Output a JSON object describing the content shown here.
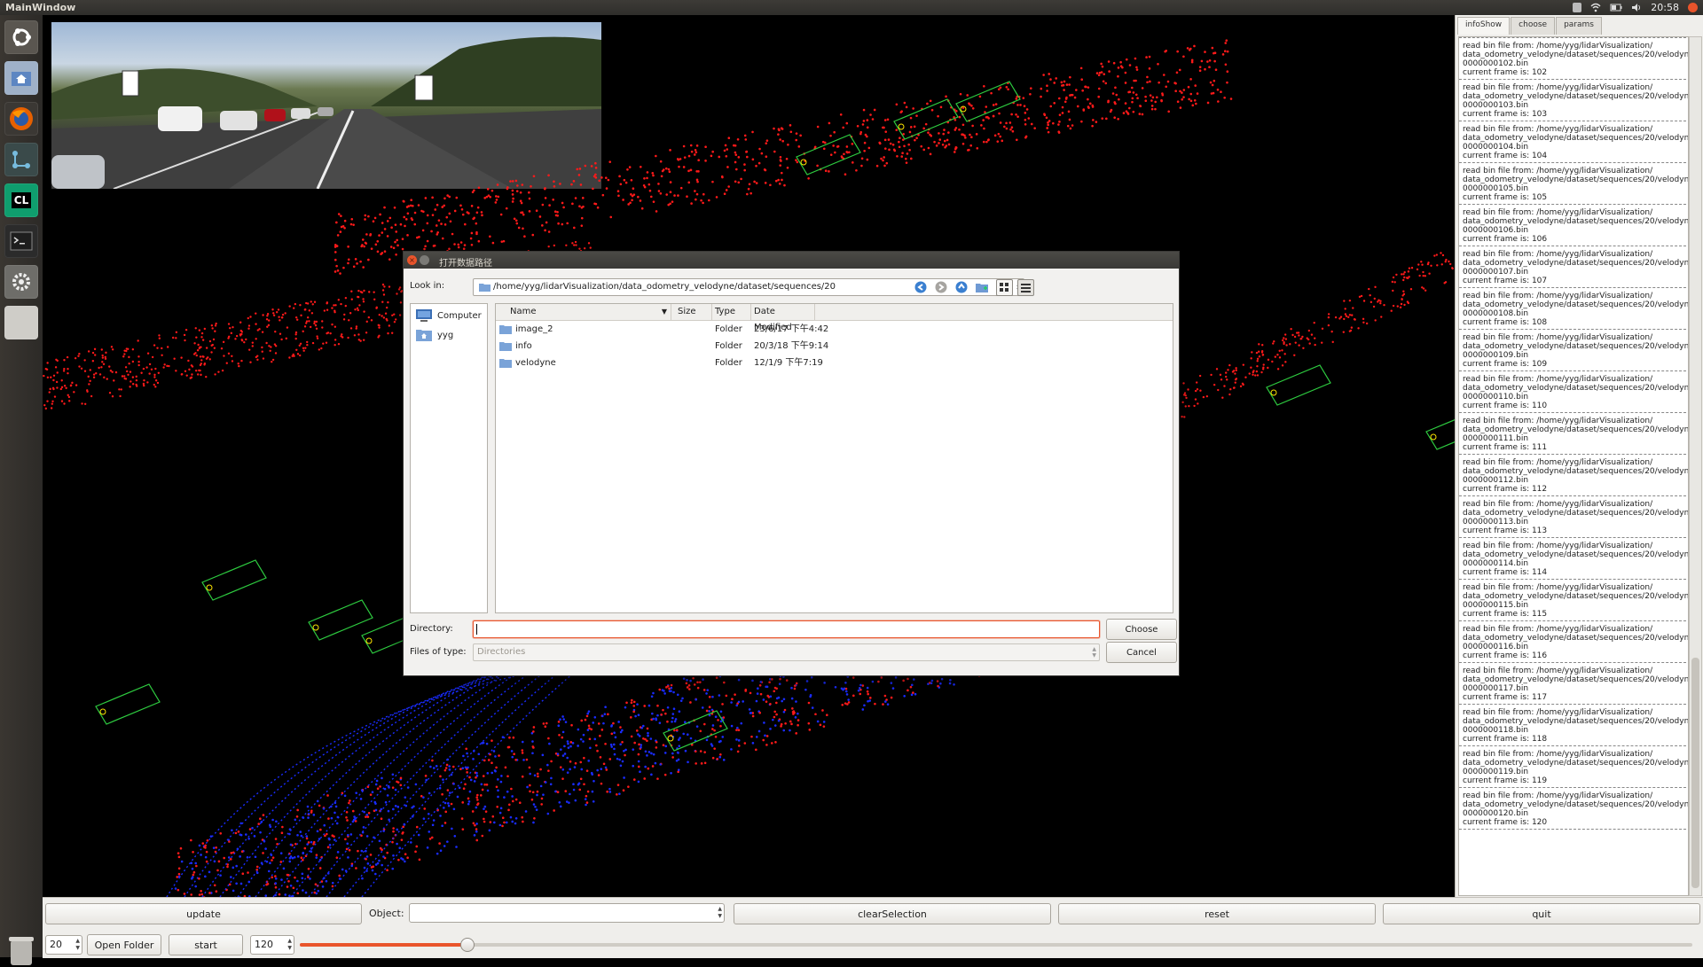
{
  "window": {
    "title": "MainWindow",
    "clock": "20:58"
  },
  "colors": {
    "accent": "#e9542b",
    "point_red": "#ff1a1a",
    "point_blue": "#1a2cff",
    "box_green": "#2ecc40",
    "box_yellow": "#ffe600"
  },
  "launcher": [
    "ubuntu-dash-icon",
    "files-icon",
    "firefox-icon",
    "network-tool-icon",
    "clion-icon",
    "terminal-icon",
    "settings-icon",
    "blank-app-icon"
  ],
  "launcher_clion_text": "CL",
  "right_panel": {
    "tabs": [
      "infoShow",
      "choose",
      "params"
    ],
    "log": [
      {
        "line1": "read bin file from: /home/yyg/lidarVisualization/",
        "line2": "data_odometry_velodyne/dataset/sequences/20/velodyne/",
        "line3": "0000000102.bin",
        "line4": "current frame is: 102"
      },
      {
        "line1": "read bin file from: /home/yyg/lidarVisualization/",
        "line2": "data_odometry_velodyne/dataset/sequences/20/velodyne/",
        "line3": "0000000103.bin",
        "line4": "current frame is: 103"
      },
      {
        "line1": "read bin file from: /home/yyg/lidarVisualization/",
        "line2": "data_odometry_velodyne/dataset/sequences/20/velodyne/",
        "line3": "0000000104.bin",
        "line4": "current frame is: 104"
      },
      {
        "line1": "read bin file from: /home/yyg/lidarVisualization/",
        "line2": "data_odometry_velodyne/dataset/sequences/20/velodyne/",
        "line3": "0000000105.bin",
        "line4": "current frame is: 105"
      },
      {
        "line1": "read bin file from: /home/yyg/lidarVisualization/",
        "line2": "data_odometry_velodyne/dataset/sequences/20/velodyne/",
        "line3": "0000000106.bin",
        "line4": "current frame is: 106"
      },
      {
        "line1": "read bin file from: /home/yyg/lidarVisualization/",
        "line2": "data_odometry_velodyne/dataset/sequences/20/velodyne/",
        "line3": "0000000107.bin",
        "line4": "current frame is: 107"
      },
      {
        "line1": "read bin file from: /home/yyg/lidarVisualization/",
        "line2": "data_odometry_velodyne/dataset/sequences/20/velodyne/",
        "line3": "0000000108.bin",
        "line4": "current frame is: 108"
      },
      {
        "line1": "read bin file from: /home/yyg/lidarVisualization/",
        "line2": "data_odometry_velodyne/dataset/sequences/20/velodyne/",
        "line3": "0000000109.bin",
        "line4": "current frame is: 109"
      },
      {
        "line1": "read bin file from: /home/yyg/lidarVisualization/",
        "line2": "data_odometry_velodyne/dataset/sequences/20/velodyne/",
        "line3": "0000000110.bin",
        "line4": "current frame is: 110"
      },
      {
        "line1": "read bin file from: /home/yyg/lidarVisualization/",
        "line2": "data_odometry_velodyne/dataset/sequences/20/velodyne/",
        "line3": "0000000111.bin",
        "line4": "current frame is: 111"
      },
      {
        "line1": "read bin file from: /home/yyg/lidarVisualization/",
        "line2": "data_odometry_velodyne/dataset/sequences/20/velodyne/",
        "line3": "0000000112.bin",
        "line4": "current frame is: 112"
      },
      {
        "line1": "read bin file from: /home/yyg/lidarVisualization/",
        "line2": "data_odometry_velodyne/dataset/sequences/20/velodyne/",
        "line3": "0000000113.bin",
        "line4": "current frame is: 113"
      },
      {
        "line1": "read bin file from: /home/yyg/lidarVisualization/",
        "line2": "data_odometry_velodyne/dataset/sequences/20/velodyne/",
        "line3": "0000000114.bin",
        "line4": "current frame is: 114"
      },
      {
        "line1": "read bin file from: /home/yyg/lidarVisualization/",
        "line2": "data_odometry_velodyne/dataset/sequences/20/velodyne/",
        "line3": "0000000115.bin",
        "line4": "current frame is: 115"
      },
      {
        "line1": "read bin file from: /home/yyg/lidarVisualization/",
        "line2": "data_odometry_velodyne/dataset/sequences/20/velodyne/",
        "line3": "0000000116.bin",
        "line4": "current frame is: 116"
      },
      {
        "line1": "read bin file from: /home/yyg/lidarVisualization/",
        "line2": "data_odometry_velodyne/dataset/sequences/20/velodyne/",
        "line3": "0000000117.bin",
        "line4": "current frame is: 117"
      },
      {
        "line1": "read bin file from: /home/yyg/lidarVisualization/",
        "line2": "data_odometry_velodyne/dataset/sequences/20/velodyne/",
        "line3": "0000000118.bin",
        "line4": "current frame is: 118"
      },
      {
        "line1": "read bin file from: /home/yyg/lidarVisualization/",
        "line2": "data_odometry_velodyne/dataset/sequences/20/velodyne/",
        "line3": "0000000119.bin",
        "line4": "current frame is: 119"
      },
      {
        "line1": "read bin file from: /home/yyg/lidarVisualization/",
        "line2": "data_odometry_velodyne/dataset/sequences/20/velodyne/",
        "line3": "0000000120.bin",
        "line4": "current frame is: 120"
      }
    ]
  },
  "controls": {
    "update": "update",
    "object_label": "Object:",
    "object_value": "",
    "clear_selection": "clearSelection",
    "reset": "reset",
    "quit": "quit",
    "spin_left": "20",
    "open_folder": "Open Folder",
    "start": "start",
    "spin_right": "120",
    "slider_fraction": 0.12
  },
  "dialog": {
    "title": "打开数据路径",
    "look_in_label": "Look in:",
    "look_in_path": "/home/yyg/lidarVisualization/data_odometry_velodyne/dataset/sequences/20",
    "places": [
      "Computer",
      "yyg"
    ],
    "columns": [
      "Name",
      "Size",
      "Type",
      "Date Modified"
    ],
    "files": [
      {
        "name": "image_2",
        "size": "",
        "type": "Folder",
        "modified": "23/6/17 下午4:42"
      },
      {
        "name": "info",
        "size": "",
        "type": "Folder",
        "modified": "20/3/18 下午9:14"
      },
      {
        "name": "velodyne",
        "size": "",
        "type": "Folder",
        "modified": "12/1/9 下午7:19"
      }
    ],
    "directory_label": "Directory:",
    "directory_value": "",
    "files_of_type_label": "Files of type:",
    "files_of_type_value": "Directories",
    "choose": "Choose",
    "cancel": "Cancel"
  }
}
